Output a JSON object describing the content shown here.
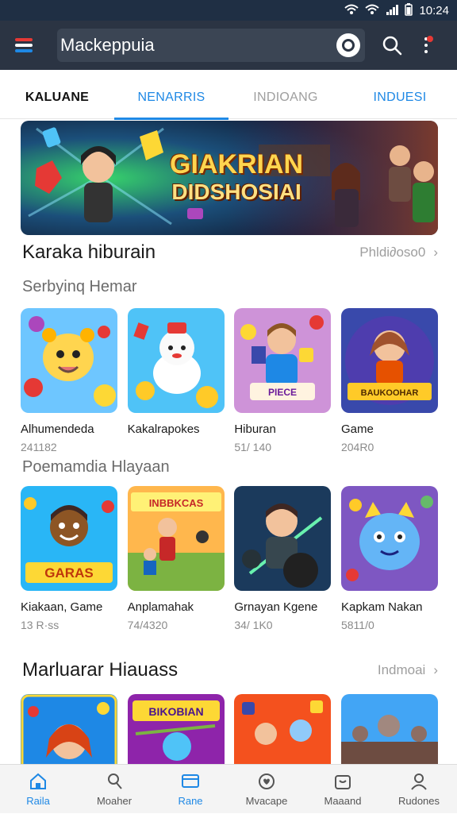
{
  "status_bar": {
    "time": "10:24"
  },
  "app_bar": {
    "search_value": "Mackeppuia"
  },
  "tabs": [
    {
      "label": "KALUANE",
      "color": "#111111"
    },
    {
      "label": "NENARRIS",
      "color": "#1e88e5"
    },
    {
      "label": "INDIOANG",
      "color": "#9e9e9e"
    },
    {
      "label": "INDUESI",
      "color": "#1e88e5"
    }
  ],
  "banner": {
    "title_line1": "GIAKRIAN",
    "title_line2": "DIDSHOSIAI"
  },
  "section1": {
    "title": "Karaka hiburain",
    "more": "Phldi∂oso0",
    "subhead1": "Serbyinq Hemar",
    "subhead2": "Poemamdia Hlayaan",
    "row1": [
      {
        "title": "Alhumendeda",
        "meta": "241182",
        "art": "bear"
      },
      {
        "title": "Kakalrapokes",
        "meta": "",
        "art": "cake"
      },
      {
        "title": "Hiburan",
        "meta": "51/ 1­40",
        "art": "boy",
        "art_text": "PIECE"
      },
      {
        "title": "Game",
        "meta": "204R0",
        "art": "girl",
        "art_text": "BAUKOOHAR"
      }
    ],
    "row2": [
      {
        "title": "Kiakaan, Game",
        "meta": "13 R·ss",
        "art": "kid",
        "art_text": "GARAS"
      },
      {
        "title": "Anplamahak",
        "meta": "74/4320",
        "art": "field",
        "art_text": "INBBKCAS"
      },
      {
        "title": "Grnayan Kgene",
        "meta": "34/ 1K0",
        "art": "hero"
      },
      {
        "title": "Kapkam Nakan",
        "meta": "5811/0",
        "art": "blob"
      }
    ]
  },
  "section2": {
    "title": "Marluarar Hiauass",
    "more": "Indmoai",
    "row": [
      {
        "art": "redhead"
      },
      {
        "art": "dog",
        "art_text": "BIKOBIAN"
      },
      {
        "art": "duo"
      },
      {
        "art": "warrior"
      }
    ]
  },
  "bottom_nav": [
    {
      "label": "Raila",
      "icon": "home-icon",
      "active": true
    },
    {
      "label": "Moaher",
      "icon": "person-icon",
      "active": false
    },
    {
      "label": "Rane",
      "icon": "card-icon",
      "active": true
    },
    {
      "label": "Mvacape",
      "icon": "heart-icon",
      "active": false
    },
    {
      "label": "Maaand",
      "icon": "bag-icon",
      "active": false
    },
    {
      "label": "Rudones",
      "icon": "profile-icon",
      "active": false
    }
  ],
  "colors": {
    "accent": "#1e88e5",
    "app_bar": "#2b3443",
    "status_bar": "#1f2f44"
  }
}
